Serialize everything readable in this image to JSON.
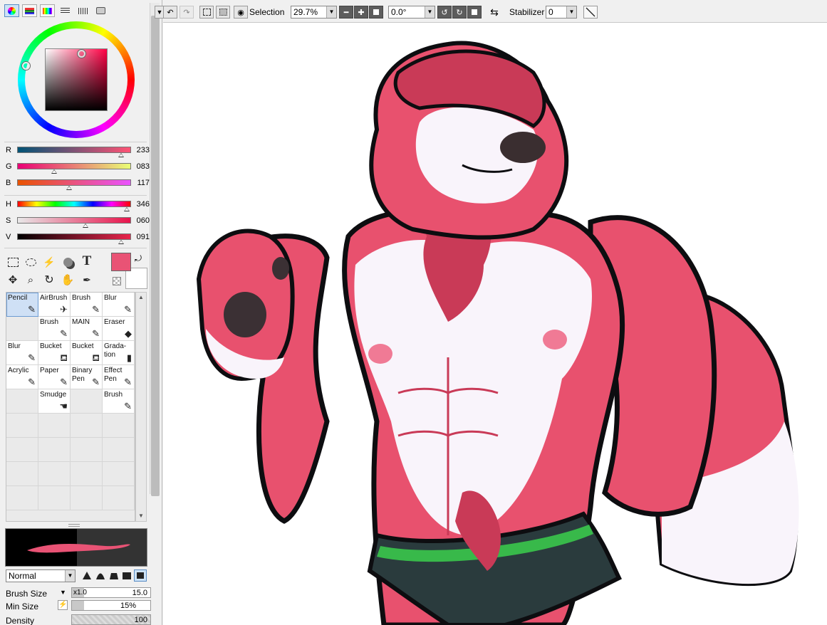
{
  "colors": {
    "current": "#e95375",
    "background": "#ffffff",
    "fur_red": "#e8516e",
    "fur_dark": "#c93a57",
    "fur_light": "#f9f4fb",
    "line": "#0d0d10",
    "briefs": "#2a3b3d",
    "briefs_band": "#38b94a"
  },
  "sliders": {
    "rgb": [
      {
        "label": "R",
        "value": "233",
        "fraction": 0.913
      },
      {
        "label": "G",
        "value": "083",
        "fraction": 0.325
      },
      {
        "label": "B",
        "value": "117",
        "fraction": 0.459
      }
    ],
    "hsv": [
      {
        "label": "H",
        "value": "346",
        "fraction": 0.961
      },
      {
        "label": "S",
        "value": "060",
        "fraction": 0.6
      },
      {
        "label": "V",
        "value": "091",
        "fraction": 0.91
      }
    ]
  },
  "tools": {
    "text_tool_glyph": "T"
  },
  "brushes": [
    {
      "name": "Pencil",
      "icon": "pencil-icon",
      "glyph": "✎",
      "selected": true
    },
    {
      "name": "AirBrush",
      "icon": "airbrush-icon",
      "glyph": "✈"
    },
    {
      "name": "Brush",
      "icon": "brush-icon",
      "glyph": "✎"
    },
    {
      "name": "Blur",
      "icon": "blur-icon",
      "glyph": "✎"
    },
    {
      "name": "",
      "empty": true
    },
    {
      "name": "Brush",
      "icon": "brush-icon",
      "glyph": "✎"
    },
    {
      "name": "MAIN",
      "icon": "brush-icon",
      "glyph": "✎"
    },
    {
      "name": "Eraser",
      "icon": "eraser-icon",
      "glyph": "◆"
    },
    {
      "name": "Blur",
      "icon": "blur-icon",
      "glyph": "✎"
    },
    {
      "name": "Bucket",
      "icon": "bucket-icon",
      "glyph": "⛾"
    },
    {
      "name": "Bucket",
      "icon": "bucket-icon",
      "glyph": "⛾"
    },
    {
      "name": "Grada-\ntion",
      "icon": "gradation-icon",
      "glyph": "▮"
    },
    {
      "name": "Acrylic",
      "icon": "acrylic-icon",
      "glyph": "✎"
    },
    {
      "name": "Paper",
      "icon": "paper-icon",
      "glyph": "✎"
    },
    {
      "name": "Binary\nPen",
      "icon": "pen-icon",
      "glyph": "✎"
    },
    {
      "name": "Effect\nPen",
      "icon": "pen-icon",
      "glyph": "✎"
    },
    {
      "name": "",
      "empty": true
    },
    {
      "name": "Smudge",
      "icon": "smudge-icon",
      "glyph": "☚"
    },
    {
      "name": "",
      "empty": true
    },
    {
      "name": "Brush",
      "icon": "brush-icon",
      "glyph": "✎"
    }
  ],
  "blend_mode": "Normal",
  "params": {
    "brush_size_label": "Brush Size",
    "brush_size_mult": "x1.0",
    "brush_size_value": "15.0",
    "brush_size_fraction": 0.15,
    "min_size_label": "Min Size",
    "min_size_value": "15%",
    "min_size_fraction": 0.15,
    "density_label": "Density",
    "density_value": "100",
    "density_fraction": 1.0
  },
  "toolbar": {
    "selection_label": "Selection",
    "zoom": "29.7%",
    "rotation": "0.0°",
    "stabilizer_label": "Stabilizer",
    "stabilizer_value": "0"
  }
}
